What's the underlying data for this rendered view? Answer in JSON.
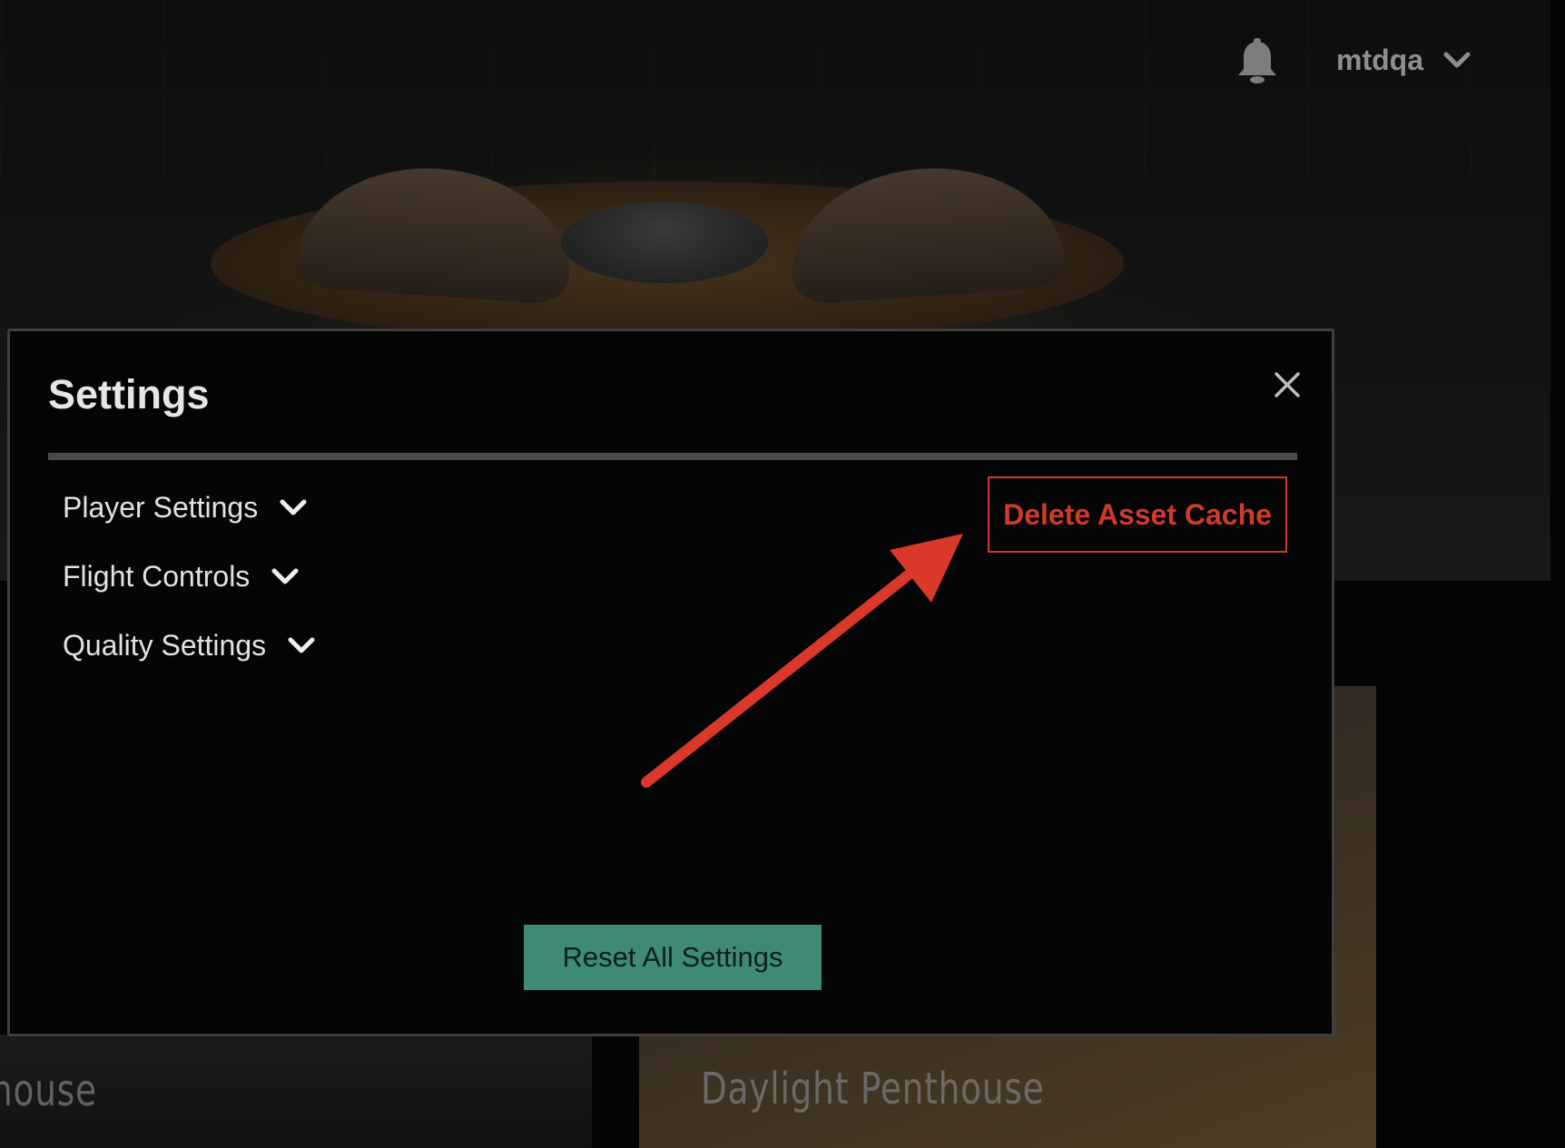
{
  "topbar": {
    "notifications_icon": "bell-icon",
    "username": "mtdqa",
    "user_menu_icon": "chevron-down-icon"
  },
  "background_cards": [
    {
      "title": "house"
    },
    {
      "title": "Daylight Penthouse"
    }
  ],
  "modal": {
    "title": "Settings",
    "close_icon": "close-icon",
    "sections": [
      {
        "label": "Player Settings",
        "icon": "chevron-down-icon"
      },
      {
        "label": "Flight Controls",
        "icon": "chevron-down-icon"
      },
      {
        "label": "Quality Settings",
        "icon": "chevron-down-icon"
      }
    ],
    "delete_cache_label": "Delete Asset Cache",
    "reset_label": "Reset All Settings"
  },
  "colors": {
    "danger": "#cf3a2a",
    "reset_button": "#3f8a76",
    "annotation_arrow": "#d9382a",
    "modal_background": "#050505"
  }
}
